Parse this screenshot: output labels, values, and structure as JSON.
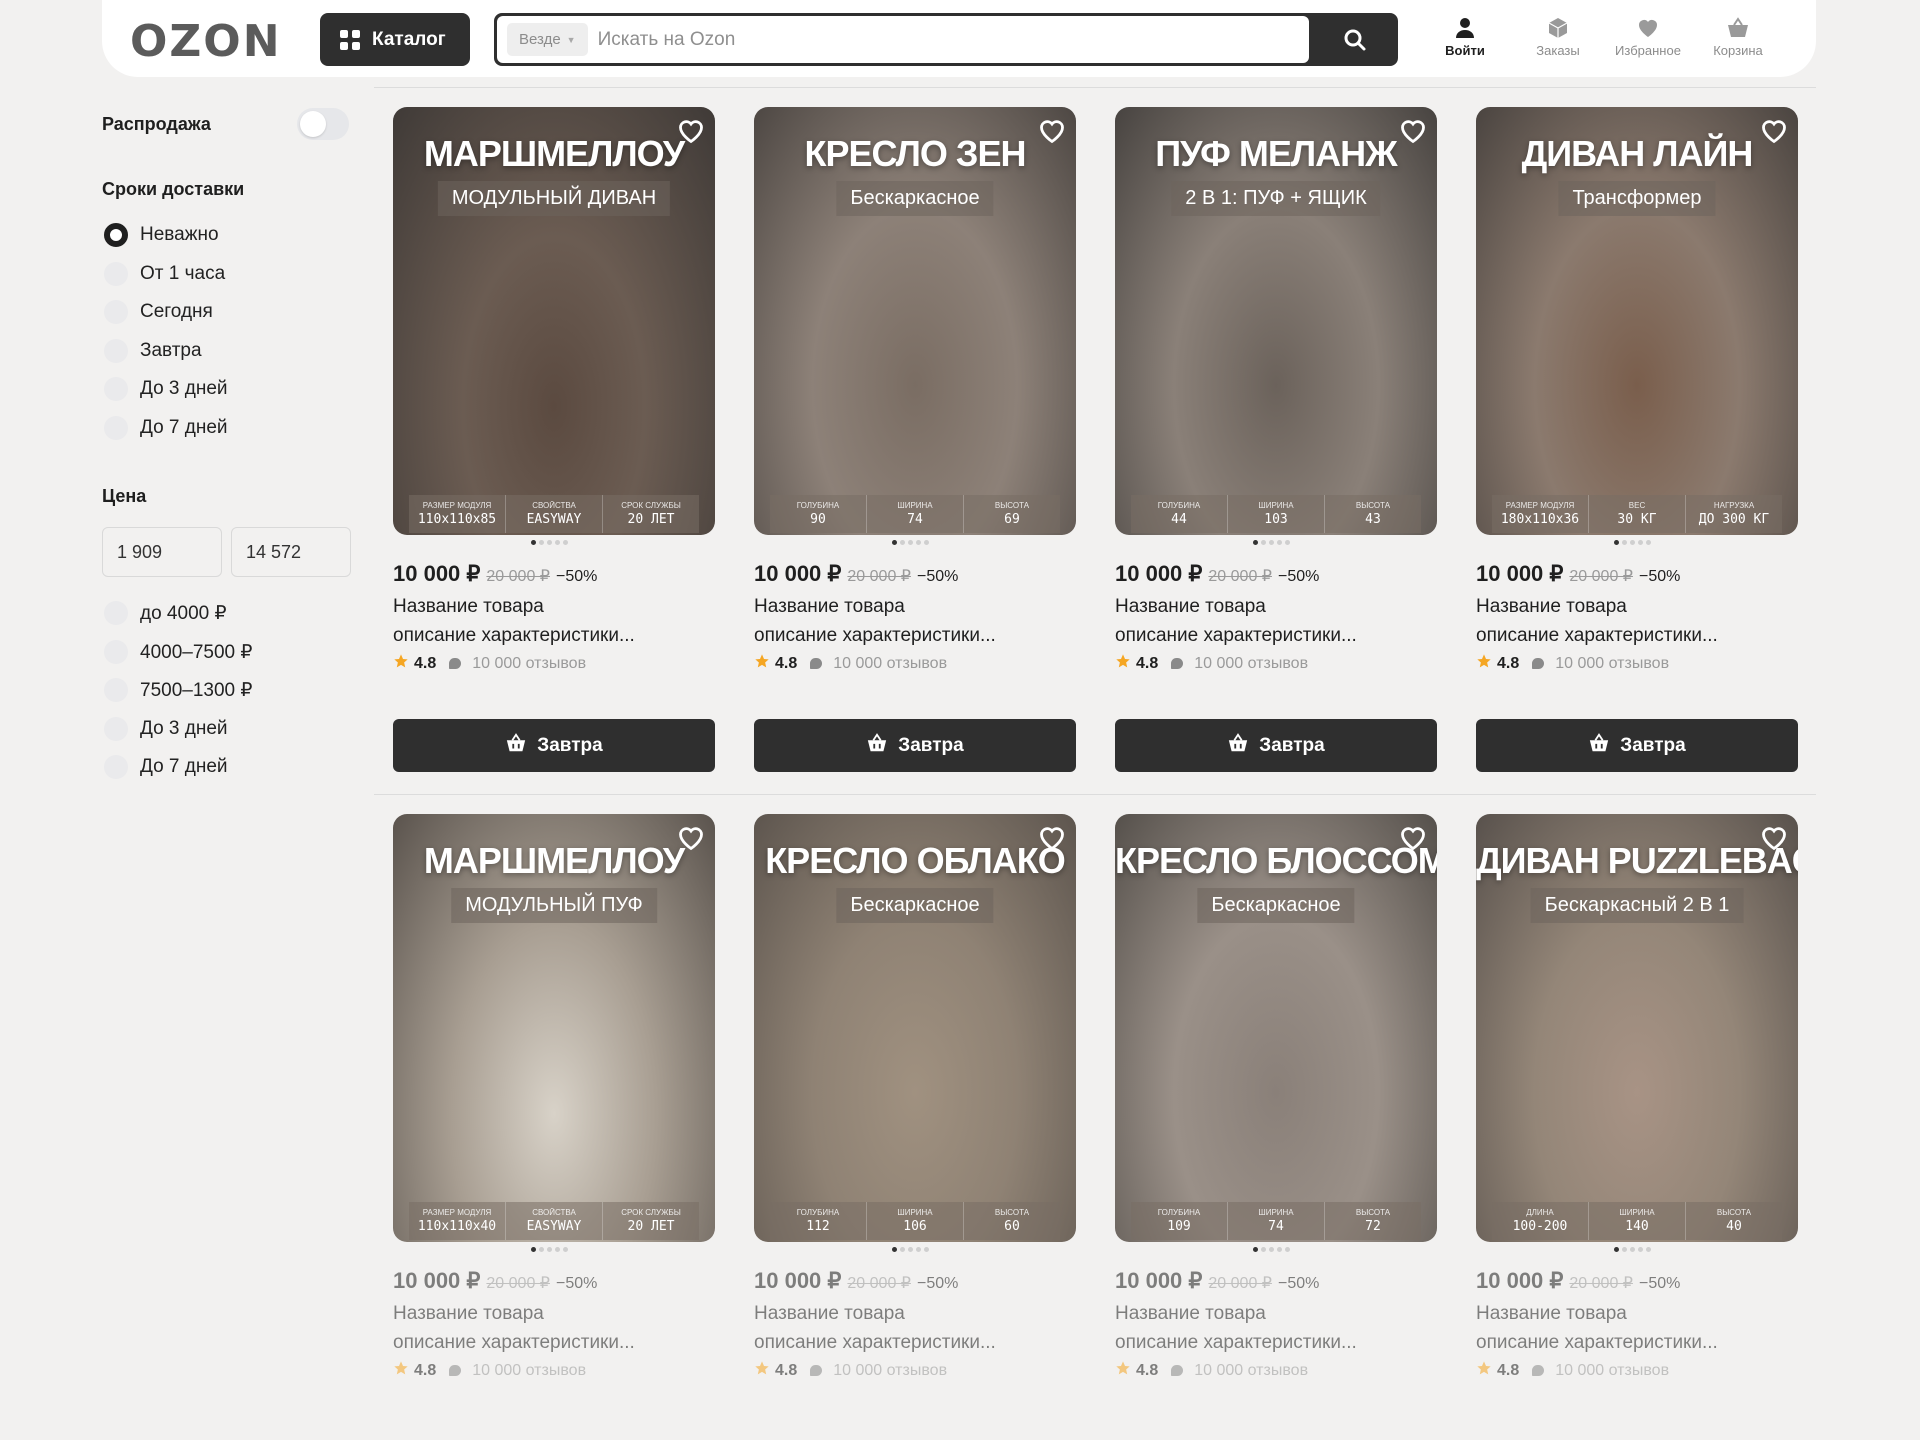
{
  "header": {
    "logo": "OZON",
    "catalog_label": "Каталог",
    "search_scope": "Везде",
    "search_placeholder": "Искать на Ozon",
    "nav": [
      {
        "label": "Войти",
        "icon": "user-icon"
      },
      {
        "label": "Заказы",
        "icon": "box-icon"
      },
      {
        "label": "Избранное",
        "icon": "heart-icon"
      },
      {
        "label": "Корзина",
        "icon": "basket-icon"
      }
    ]
  },
  "sidebar": {
    "sale_label": "Распродажа",
    "sale_enabled": false,
    "delivery_title": "Сроки доставки",
    "delivery_options": [
      "Неважно",
      "От 1 часа",
      "Сегодня",
      "Завтра",
      "До 3 дней",
      "До 7 дней"
    ],
    "delivery_selected": "Неважно",
    "price_title": "Цена",
    "price_min": "1 909",
    "price_max": "14 572",
    "price_options": [
      "до 4000 ₽",
      "4000–7500 ₽",
      "7500–1300 ₽",
      "До 3 дней",
      "До 7 дней"
    ]
  },
  "products": [
    {
      "title": "МАРШМЕЛЛОУ",
      "subtitle": "МОДУЛЬНЫЙ ДИВАН",
      "specs": [
        {
          "k": "РАЗМЕР МОДУЛЯ",
          "v": "110x110x85"
        },
        {
          "k": "СВОЙСТВА",
          "v": "EASYWAY"
        },
        {
          "k": "СРОК СЛУЖБЫ",
          "v": "20 ЛЕТ"
        }
      ],
      "price": "10 000 ₽",
      "old_price": "20 000 ₽",
      "discount": "−50%",
      "name": "Название товара",
      "desc": "описание характеристики...",
      "rating": "4.8",
      "reviews": "10 000 отзывов",
      "delivery": "Завтра"
    },
    {
      "title": "КРЕСЛО ЗЕН",
      "subtitle": "Бескаркасное",
      "specs": [
        {
          "k": "ГОЛУБИНА",
          "v": "90"
        },
        {
          "k": "ШИРИНА",
          "v": "74"
        },
        {
          "k": "ВЫСОТА",
          "v": "69"
        }
      ],
      "price": "10 000 ₽",
      "old_price": "20 000 ₽",
      "discount": "−50%",
      "name": "Название товара",
      "desc": "описание характеристики...",
      "rating": "4.8",
      "reviews": "10 000 отзывов",
      "delivery": "Завтра"
    },
    {
      "title": "ПУФ МЕЛАНЖ",
      "subtitle": "2 В 1: ПУФ + ЯЩИК",
      "specs": [
        {
          "k": "ГОЛУБИНА",
          "v": "44"
        },
        {
          "k": "ШИРИНА",
          "v": "103"
        },
        {
          "k": "ВЫСОТА",
          "v": "43"
        }
      ],
      "price": "10 000 ₽",
      "old_price": "20 000 ₽",
      "discount": "−50%",
      "name": "Название товара",
      "desc": "описание характеристики...",
      "rating": "4.8",
      "reviews": "10 000 отзывов",
      "delivery": "Завтра"
    },
    {
      "title": "ДИВАН ЛАЙН",
      "subtitle": "Трансформер",
      "specs": [
        {
          "k": "РАЗМЕР МОДУЛЯ",
          "v": "180x110x36"
        },
        {
          "k": "ВЕС",
          "v": "30 КГ"
        },
        {
          "k": "НАГРУЗКА",
          "v": "ДО 300 КГ"
        }
      ],
      "price": "10 000 ₽",
      "old_price": "20 000 ₽",
      "discount": "−50%",
      "name": "Название товара",
      "desc": "описание характеристики...",
      "rating": "4.8",
      "reviews": "10 000 отзывов",
      "delivery": "Завтра"
    },
    {
      "title": "МАРШМЕЛЛОУ",
      "subtitle": "МОДУЛЬНЫЙ ПУФ",
      "specs": [
        {
          "k": "РАЗМЕР МОДУЛЯ",
          "v": "110x110x40"
        },
        {
          "k": "СВОЙСТВА",
          "v": "EASYWAY"
        },
        {
          "k": "СРОК СЛУЖБЫ",
          "v": "20 ЛЕТ"
        }
      ],
      "price": "10 000 ₽",
      "old_price": "20 000 ₽",
      "discount": "−50%",
      "name": "Название товара",
      "desc": "описание характеристики...",
      "rating": "4.8",
      "reviews": "10 000 отзывов"
    },
    {
      "title": "КРЕСЛО ОБЛАКО",
      "subtitle": "Бескаркасное",
      "specs": [
        {
          "k": "ГОЛУБИНА",
          "v": "112"
        },
        {
          "k": "ШИРИНА",
          "v": "106"
        },
        {
          "k": "ВЫСОТА",
          "v": "60"
        }
      ],
      "price": "10 000 ₽",
      "old_price": "20 000 ₽",
      "discount": "−50%",
      "name": "Название товара",
      "desc": "описание характеристики...",
      "rating": "4.8",
      "reviews": "10 000 отзывов"
    },
    {
      "title": "КРЕСЛО БЛОССОМ",
      "subtitle": "Бескаркасное",
      "specs": [
        {
          "k": "ГОЛУБИНА",
          "v": "109"
        },
        {
          "k": "ШИРИНА",
          "v": "74"
        },
        {
          "k": "ВЫСОТА",
          "v": "72"
        }
      ],
      "price": "10 000 ₽",
      "old_price": "20 000 ₽",
      "discount": "−50%",
      "name": "Название товара",
      "desc": "описание характеристики...",
      "rating": "4.8",
      "reviews": "10 000 отзывов"
    },
    {
      "title": "ДИВАН PUZZLEBAG",
      "subtitle": "Бескаркасный 2 В 1",
      "specs": [
        {
          "k": "ДЛИНА",
          "v": "100-200"
        },
        {
          "k": "ШИРИНА",
          "v": "140"
        },
        {
          "k": "ВЫСОТА",
          "v": "40"
        }
      ],
      "price": "10 000 ₽",
      "old_price": "20 000 ₽",
      "discount": "−50%",
      "name": "Название товара",
      "desc": "описание характеристики...",
      "rating": "4.8",
      "reviews": "10 000 отзывов"
    }
  ],
  "colors": {
    "accent": "#2f2f2f",
    "star": "#f5a623",
    "background": "#f2f1f0"
  }
}
